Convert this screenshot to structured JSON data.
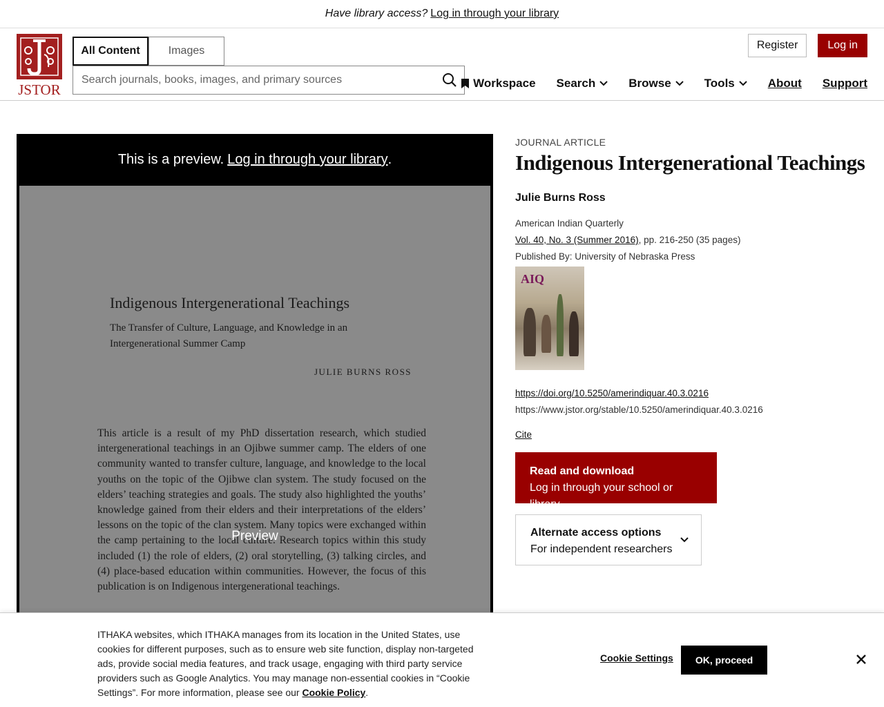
{
  "top_banner": {
    "question": "Have library access?",
    "link": "Log in through your library"
  },
  "header": {
    "logo_text": "JSTOR",
    "tabs": [
      {
        "label": "All Content"
      },
      {
        "label": "Images"
      }
    ],
    "search": {
      "placeholder": "Search journals, books, images, and primary sources",
      "icon": "search-icon"
    },
    "register_label": "Register",
    "login_label": "Log in",
    "nav": {
      "workspace": "Workspace",
      "search": "Search",
      "browse": "Browse",
      "tools": "Tools",
      "about": "About",
      "support": "Support"
    }
  },
  "preview": {
    "message": "This is a preview.",
    "link": "Log in through your library",
    "period": ".",
    "label": "Preview",
    "page": {
      "title": "Indigenous Intergenerational Teachings",
      "subtitle": "The Transfer of Culture, Language, and Knowledge in an Intergenerational Summer Camp",
      "author": "JULIE BURNS ROSS",
      "body": "This article is a result of my PhD dissertation research, which studied intergenerational teachings in an Ojibwe summer camp. The elders of one community wanted to transfer culture, language, and knowledge to the local youths on the topic of the Ojibwe clan system. The study focused on the elders’ teaching strategies and goals. The study also highlighted the youths’ knowledge gained from their elders and their interpretations of the elders’ lessons on the topic of the clan system. Many topics were exchanged within the camp pertaining to the local culture. Research topics within this study included (1) the role of elders, (2) oral storytelling, (3) talking circles, and (4) place-based education within communities. However, the focus of this publication is on Indigenous intergenerational teachings."
    }
  },
  "article": {
    "type": "JOURNAL ARTICLE",
    "title": "Indigenous Intergenerational Teachings",
    "author": "Julie Burns Ross",
    "journal": "American Indian Quarterly",
    "issue_link": "Vol. 40, No. 3 (Summer 2016)",
    "pages": ", pp. 216-250 (35 pages)",
    "publisher": "Published By: University of Nebraska Press",
    "cover_text": "AIQ",
    "doi": "https://doi.org/10.5250/amerindiquar.40.3.0216",
    "stable_url": "https://www.jstor.org/stable/10.5250/amerindiquar.40.3.0216",
    "cite": "Cite",
    "read_button": {
      "title": "Read and download",
      "subtitle": "Log in through your school or library"
    },
    "alt_button": {
      "title": "Alternate access options",
      "subtitle": "For independent researchers"
    }
  },
  "cookie": {
    "text": "ITHAKA websites, which ITHAKA manages from its location in the United States, use cookies for different purposes, such as to ensure web site function, display non-targeted ads, provide social media features, and track usage, engaging with third party service providers such as Google Analytics. You may manage non-essential cookies in “Cookie Settings”. For more information, please see our ",
    "policy_link": "Cookie Policy",
    "period": ".",
    "settings": "Cookie Settings",
    "ok": "OK, proceed"
  },
  "colors": {
    "brand_red": "#990000",
    "preview_bg": "#000000"
  }
}
